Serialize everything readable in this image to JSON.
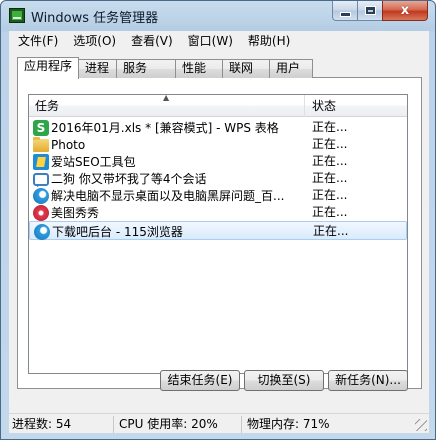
{
  "window": {
    "title": "Windows 任务管理器",
    "close_glyph": "x"
  },
  "menubar": {
    "items": [
      {
        "label": "文件(F)"
      },
      {
        "label": "选项(O)"
      },
      {
        "label": "查看(V)"
      },
      {
        "label": "窗口(W)"
      },
      {
        "label": "帮助(H)"
      }
    ]
  },
  "tabs": [
    {
      "label": "应用程序",
      "active": true
    },
    {
      "label": "进程"
    },
    {
      "label": "服务"
    },
    {
      "label": "性能"
    },
    {
      "label": "联网"
    },
    {
      "label": "用户"
    }
  ],
  "tasklist": {
    "columns": {
      "task": "任务",
      "status": "状态"
    },
    "sort_glyph": "▲",
    "rows": [
      {
        "icon": "wps-spreadsheet-icon",
        "icon_glyph": "S",
        "task": "2016年01月.xls * [兼容模式] - WPS 表格",
        "status": "正在..."
      },
      {
        "icon": "folder-icon",
        "task": "Photo",
        "status": "正在..."
      },
      {
        "icon": "seo-toolkit-icon",
        "task": "爱站SEO工具包",
        "status": "正在..."
      },
      {
        "icon": "chat-icon",
        "task": "二狗 你又带坏我了等4个会话",
        "status": "正在..."
      },
      {
        "icon": "browser-icon",
        "task": "解决电脑不显示桌面以及电脑黑屏问题_百...",
        "status": "正在..."
      },
      {
        "icon": "meitu-icon",
        "task": "美图秀秀",
        "status": "正在..."
      },
      {
        "icon": "browser-icon",
        "task": "下载吧后台 - 115浏览器",
        "status": "正在...",
        "selected": true
      }
    ]
  },
  "buttons": {
    "end_task": "结束任务(E)",
    "switch_to": "切换至(S)",
    "new_task": "新任务(N)..."
  },
  "statusbar": {
    "processes": "进程数: 54",
    "cpu": "CPU 使用率: 20%",
    "memory": "物理内存: 71%"
  },
  "colors": {
    "selection_border": "#aacdf3",
    "close_button": "#c0391f"
  }
}
